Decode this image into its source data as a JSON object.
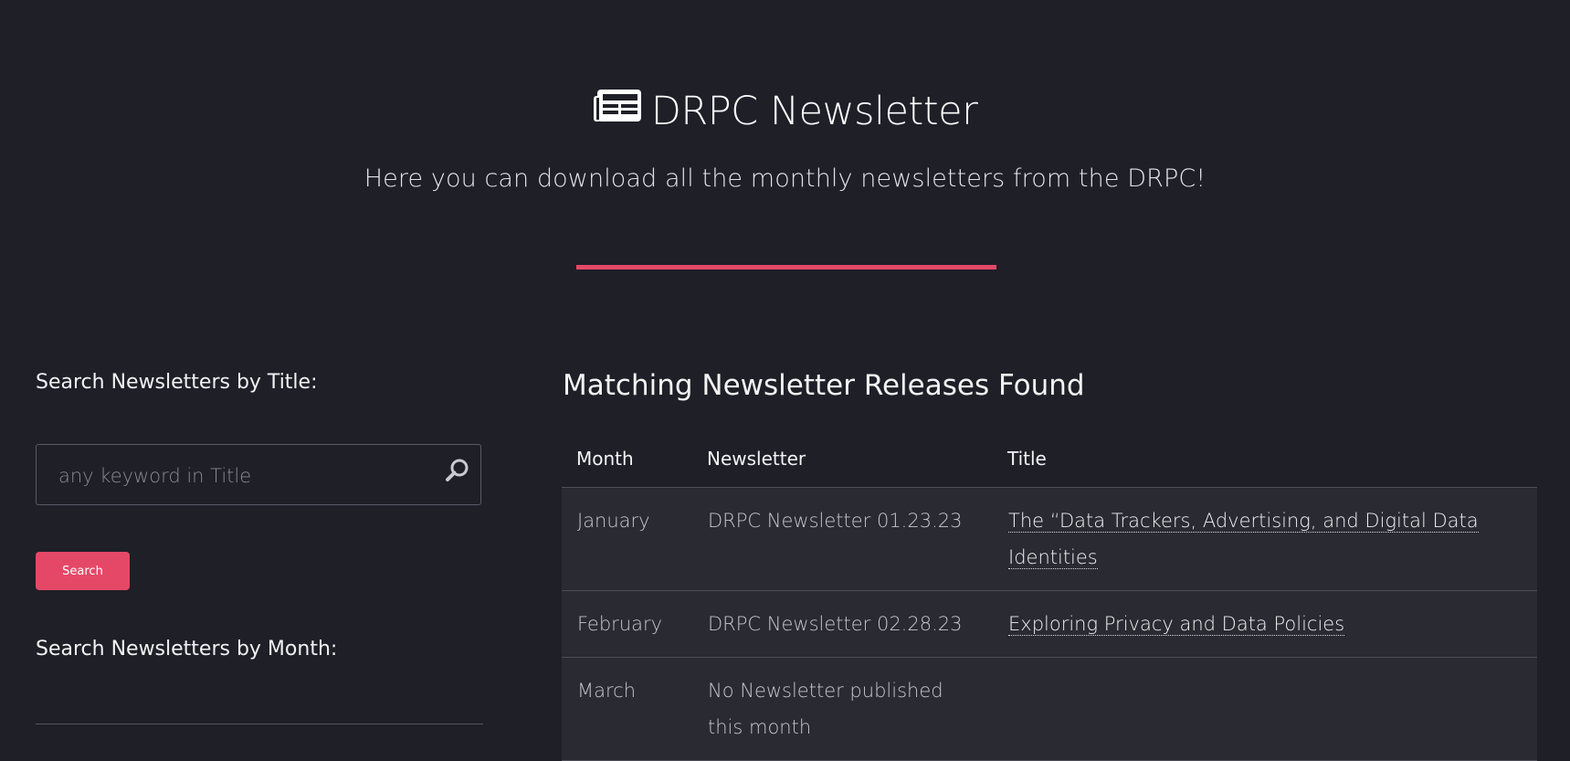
{
  "hero": {
    "title": "DRPC Newsletter",
    "icon": "newspaper-icon",
    "subtitle": "Here you can download all the monthly newsletters from the DRPC!",
    "accent_color": "#e54867"
  },
  "sidebar": {
    "search_title_label": "Search Newsletters by Title:",
    "search_placeholder": "any keyword in Title",
    "search_value": "",
    "search_icon": "search-icon",
    "search_button_label": "Search",
    "search_month_label": "Search Newsletters by Month:"
  },
  "results": {
    "heading": "Matching Newsletter Releases Found",
    "columns": [
      "Month",
      "Newsletter",
      "Title"
    ],
    "rows": [
      {
        "month": "January",
        "newsletter": "DRPC Newsletter 01.23.23",
        "title": "The “Data Trackers, Advertising, and Digital Data Identities"
      },
      {
        "month": "February",
        "newsletter": "DRPC Newsletter 02.28.23",
        "title": "Exploring Privacy and Data Policies"
      },
      {
        "month": "March",
        "newsletter": "No Newsletter published this month",
        "title": ""
      }
    ]
  },
  "colors": {
    "background": "#1f1f28",
    "row_background": "#2a2a33",
    "accent": "#e54867"
  }
}
